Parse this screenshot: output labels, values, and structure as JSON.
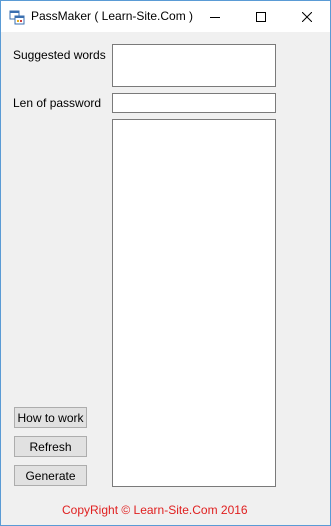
{
  "window": {
    "title": "PassMaker ( Learn-Site.Com )"
  },
  "form": {
    "suggested_words_label": "Suggested words",
    "suggested_words_value": "",
    "password_length_label": "Len of password",
    "password_length_value": "",
    "output_value": ""
  },
  "buttons": {
    "how_to_work": "How to work",
    "refresh": "Refresh",
    "generate": "Generate"
  },
  "footer": {
    "copyright": "CopyRight © Learn-Site.Com 2016"
  },
  "colors": {
    "copyright_text": "#e02020",
    "window_border": "#5a9bd5",
    "client_background": "#f0f0f0"
  },
  "icons": {
    "app": "app-window-icon",
    "minimize": "minimize-icon",
    "maximize": "maximize-icon",
    "close": "close-icon"
  }
}
